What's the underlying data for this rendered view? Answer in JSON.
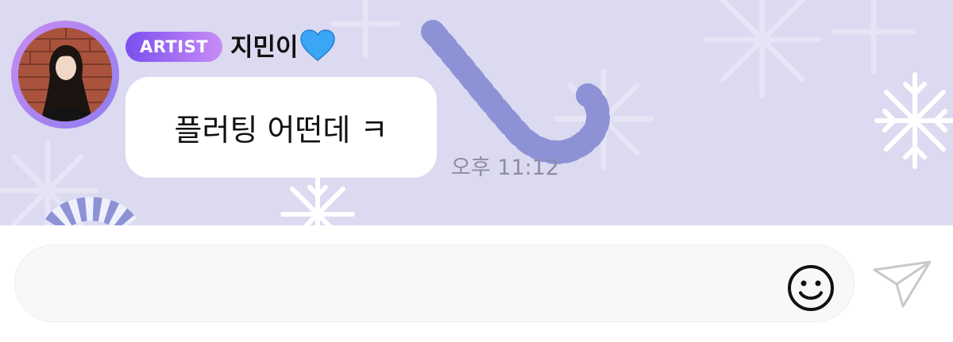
{
  "message": {
    "badge": "ARTIST",
    "sender_name": "지민이",
    "sender_emoji": "blue-heart-icon",
    "text": "플러팅 어떤데 ㅋ",
    "time": "오후 11:12"
  },
  "composer": {
    "input_value": "",
    "emoji_icon": "smiley-face-icon",
    "send_icon": "paper-plane-icon"
  },
  "colors": {
    "chat_background": "#dcdaf0",
    "badge_gradient_start": "#7b4ff0",
    "badge_gradient_end": "#c88cf5",
    "heart": "#3aa6f5",
    "candy_stripe": "#8d92d6"
  }
}
